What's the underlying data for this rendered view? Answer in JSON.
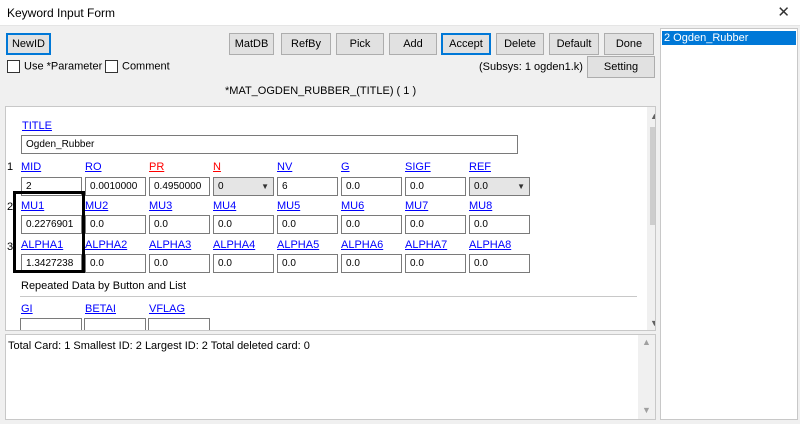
{
  "window": {
    "title": "Keyword Input Form",
    "close": "✕"
  },
  "toolbar": {
    "newid": "NewID",
    "matdb": "MatDB",
    "refby": "RefBy",
    "pick": "Pick",
    "add": "Add",
    "accept": "Accept",
    "delete": "Delete",
    "default": "Default",
    "done": "Done",
    "setting": "Setting"
  },
  "options": {
    "use_parameter": "Use *Parameter",
    "comment": "Comment"
  },
  "subsys": "(Subsys: 1 ogden1.k)",
  "card_title": "*MAT_OGDEN_RUBBER_(TITLE)   ( 1 )",
  "title_field": {
    "label": "TITLE",
    "value": "Ogden_Rubber"
  },
  "row1": {
    "num": "1",
    "fields": [
      {
        "label": "MID",
        "value": "2"
      },
      {
        "label": "RO",
        "value": "0.0010000"
      },
      {
        "label": "PR",
        "value": "0.4950000"
      },
      {
        "label": "N",
        "value": "0"
      },
      {
        "label": "NV",
        "value": "6"
      },
      {
        "label": "G",
        "value": "0.0"
      },
      {
        "label": "SIGF",
        "value": "0.0"
      },
      {
        "label": "REF",
        "value": "0.0"
      }
    ]
  },
  "row2": {
    "num": "2",
    "fields": [
      {
        "label": "MU1",
        "value": "0.2276901"
      },
      {
        "label": "MU2",
        "value": "0.0"
      },
      {
        "label": "MU3",
        "value": "0.0"
      },
      {
        "label": "MU4",
        "value": "0.0"
      },
      {
        "label": "MU5",
        "value": "0.0"
      },
      {
        "label": "MU6",
        "value": "0.0"
      },
      {
        "label": "MU7",
        "value": "0.0"
      },
      {
        "label": "MU8",
        "value": "0.0"
      }
    ]
  },
  "row3": {
    "num": "3",
    "fields": [
      {
        "label": "ALPHA1",
        "value": "1.3427238"
      },
      {
        "label": "ALPHA2",
        "value": "0.0"
      },
      {
        "label": "ALPHA3",
        "value": "0.0"
      },
      {
        "label": "ALPHA4",
        "value": "0.0"
      },
      {
        "label": "ALPHA5",
        "value": "0.0"
      },
      {
        "label": "ALPHA6",
        "value": "0.0"
      },
      {
        "label": "ALPHA7",
        "value": "0.0"
      },
      {
        "label": "ALPHA8",
        "value": "0.0"
      }
    ]
  },
  "repeated": {
    "heading": "Repeated Data by Button and List",
    "cols": [
      "GI",
      "BETAI",
      "VFLAG"
    ]
  },
  "status_text": "Total Card: 1    Smallest ID: 2    Largest ID: 2    Total deleted card:  0",
  "list_item": "2   Ogden_Rubber",
  "colors": {
    "link": "#0000ff",
    "required": "#ff0000",
    "selection": "#0078d7"
  }
}
